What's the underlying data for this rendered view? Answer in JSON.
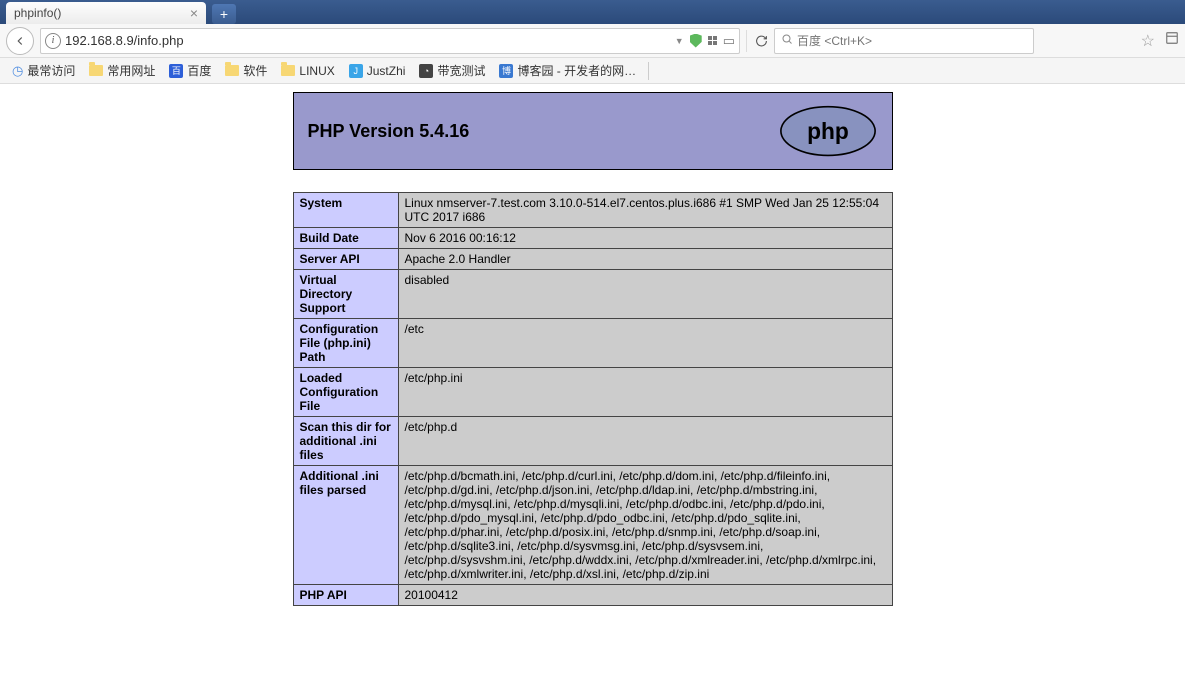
{
  "tab": {
    "title": "phpinfo()"
  },
  "url": "192.168.8.9/info.php",
  "search": {
    "placeholder": "百度 <Ctrl+K>"
  },
  "bookmarks": {
    "frequent": "最常访问",
    "common": "常用网址",
    "baidu": "百度",
    "software": "软件",
    "linux": "LINUX",
    "justzhi": "JustZhi",
    "speedtest": "带宽测试",
    "cnblogs": "博客园 - 开发者的网…"
  },
  "php": {
    "title": "PHP Version 5.4.16",
    "rows": [
      {
        "k": "System",
        "v": "Linux nmserver-7.test.com 3.10.0-514.el7.centos.plus.i686 #1 SMP Wed Jan 25 12:55:04 UTC 2017 i686"
      },
      {
        "k": "Build Date",
        "v": "Nov 6 2016 00:16:12"
      },
      {
        "k": "Server API",
        "v": "Apache 2.0 Handler"
      },
      {
        "k": "Virtual Directory Support",
        "v": "disabled"
      },
      {
        "k": "Configuration File (php.ini) Path",
        "v": "/etc"
      },
      {
        "k": "Loaded Configuration File",
        "v": "/etc/php.ini"
      },
      {
        "k": "Scan this dir for additional .ini files",
        "v": "/etc/php.d"
      },
      {
        "k": "Additional .ini files parsed",
        "v": "/etc/php.d/bcmath.ini, /etc/php.d/curl.ini, /etc/php.d/dom.ini, /etc/php.d/fileinfo.ini, /etc/php.d/gd.ini, /etc/php.d/json.ini, /etc/php.d/ldap.ini, /etc/php.d/mbstring.ini, /etc/php.d/mysql.ini, /etc/php.d/mysqli.ini, /etc/php.d/odbc.ini, /etc/php.d/pdo.ini, /etc/php.d/pdo_mysql.ini, /etc/php.d/pdo_odbc.ini, /etc/php.d/pdo_sqlite.ini, /etc/php.d/phar.ini, /etc/php.d/posix.ini, /etc/php.d/snmp.ini, /etc/php.d/soap.ini, /etc/php.d/sqlite3.ini, /etc/php.d/sysvmsg.ini, /etc/php.d/sysvsem.ini, /etc/php.d/sysvshm.ini, /etc/php.d/wddx.ini, /etc/php.d/xmlreader.ini, /etc/php.d/xmlrpc.ini, /etc/php.d/xmlwriter.ini, /etc/php.d/xsl.ini, /etc/php.d/zip.ini"
      },
      {
        "k": "PHP API",
        "v": "20100412"
      }
    ]
  }
}
